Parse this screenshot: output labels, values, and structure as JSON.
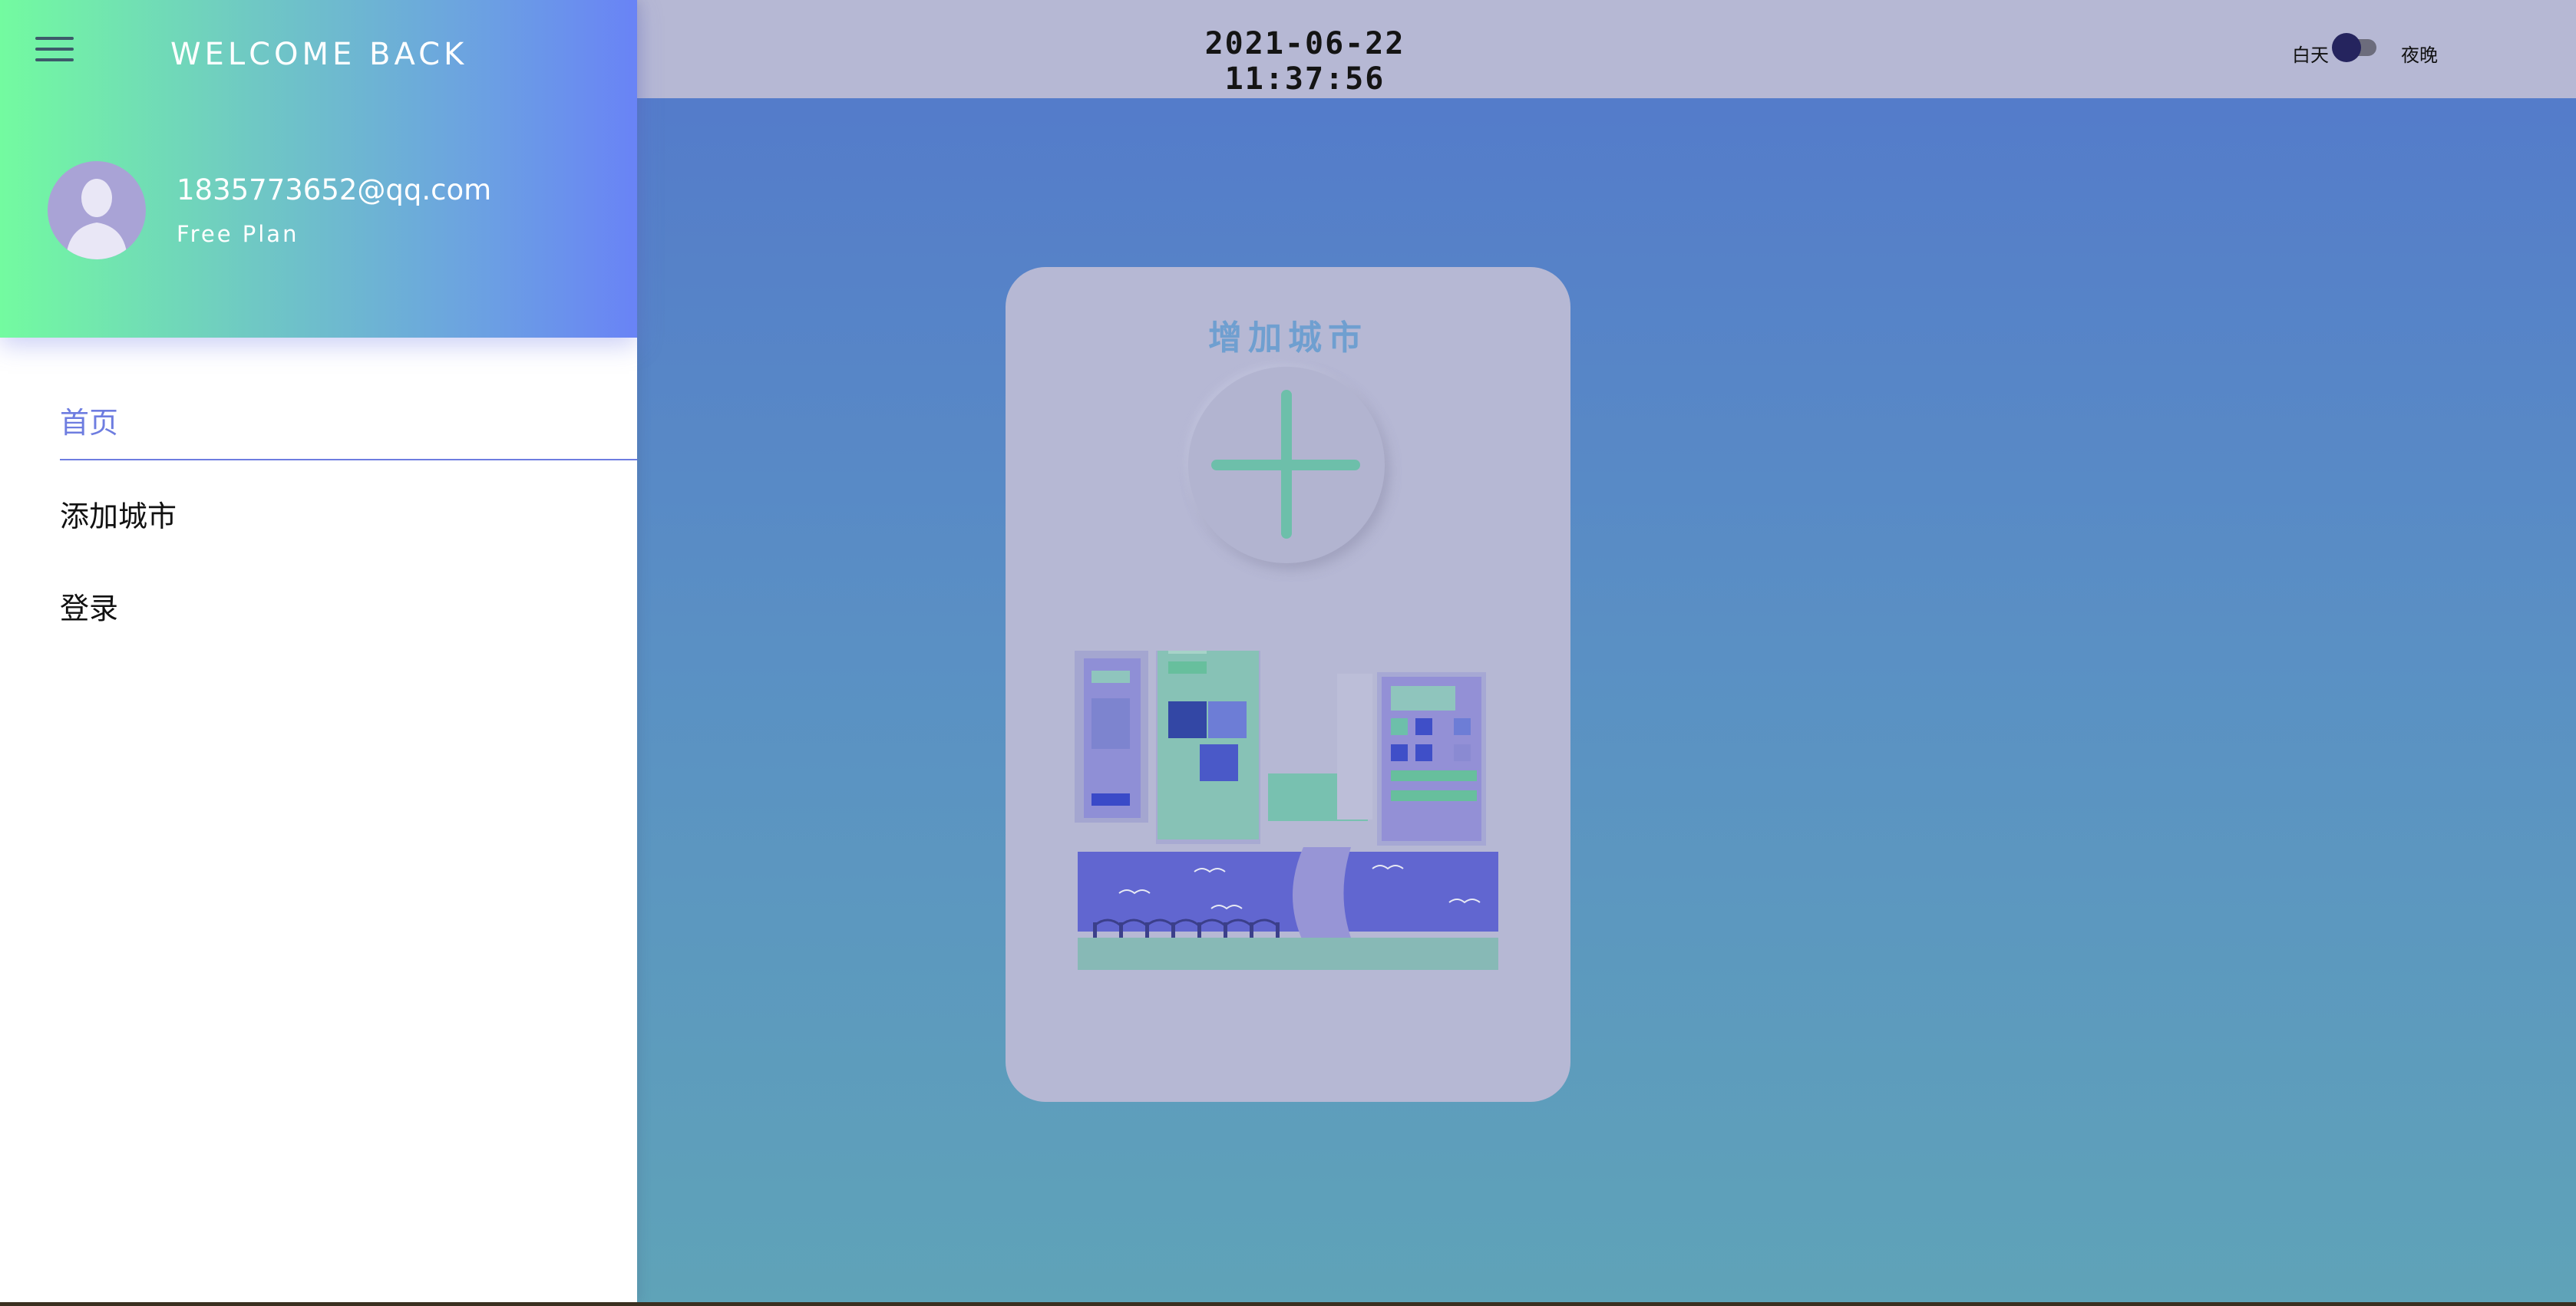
{
  "topbar": {
    "datetime": "2021-06-22 11:37:56",
    "mode_day": "白天",
    "mode_night": "夜晚"
  },
  "sidebar": {
    "welcome": "WELCOME BACK",
    "email": "1835773652@qq.com",
    "plan": "Free Plan",
    "items": [
      {
        "label": "首页",
        "active": true
      },
      {
        "label": "添加城市",
        "active": false
      },
      {
        "label": "登录",
        "active": false
      }
    ]
  },
  "card": {
    "title": "增加城市"
  },
  "colors": {
    "accent": "#6e7de0",
    "topbar": "#b6b8d4",
    "card_title": "#6f9fd0",
    "plus": "#6dbfaa",
    "header_gradient_start": "#73fba0",
    "header_gradient_end": "#6983f6"
  },
  "icons": {
    "menu": "hamburger-icon",
    "avatar": "user-silhouette-icon",
    "add": "plus-icon",
    "illustration": "city-illustration"
  }
}
